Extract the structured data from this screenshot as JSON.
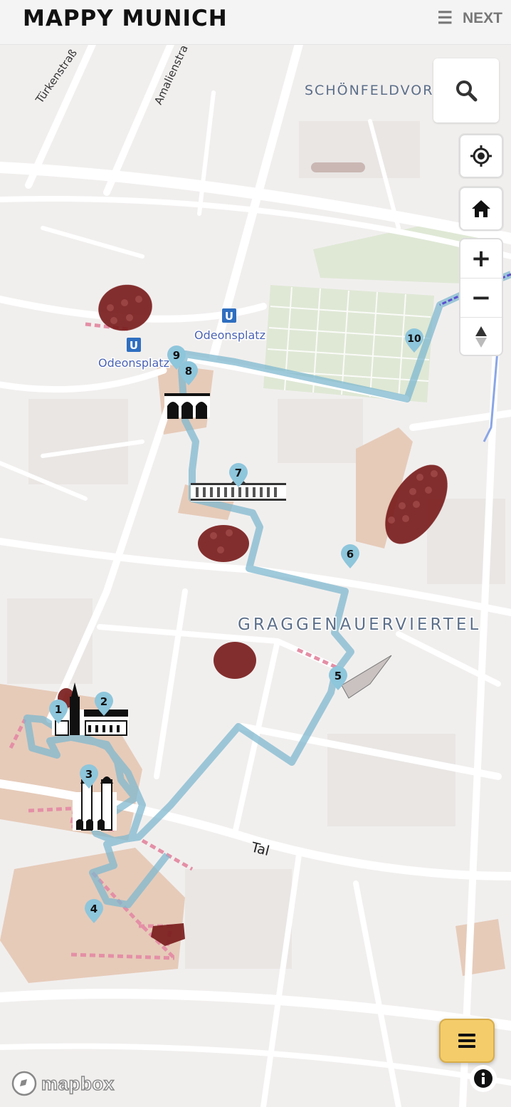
{
  "header": {
    "brand": "MAPPY MUNICH",
    "next_label": "NEXT",
    "menu_icon": "hamburger-icon"
  },
  "map": {
    "district_labels": [
      {
        "name": "district-label-schoenfeldvorstadt",
        "text": "SCHÖNFELDVOR"
      },
      {
        "name": "district-label-graggenauerviertel",
        "text": "GRAGGENAUERVIERTEL"
      }
    ],
    "street_labels": [
      {
        "name": "street-label-tuerkenstrasse",
        "text": "Türkenstraß"
      },
      {
        "name": "street-label-amalienstrasse",
        "text": "Amalienstra"
      },
      {
        "name": "street-label-tal",
        "text": "Tal"
      }
    ],
    "transit_stations": [
      {
        "name": "ubahn-odeonsplatz-east",
        "symbol": "U",
        "label": "Odeonsplatz"
      },
      {
        "name": "ubahn-odeonsplatz-west",
        "symbol": "U",
        "label": "Odeonsplatz"
      }
    ],
    "route_markers": [
      "1",
      "2",
      "3",
      "4",
      "5",
      "6",
      "7",
      "8",
      "9",
      "10"
    ],
    "colors": {
      "route": "#7fb8cf",
      "marker": "#8ec6dc",
      "area": "#7a1d1d",
      "pedestrian": "#e6cbb9",
      "park": "#dfe8d5",
      "label_blue": "#4a63b5",
      "menu_accent": "#f4cc6a"
    }
  },
  "controls": {
    "search_icon": "search-icon",
    "locate_icon": "locate-icon",
    "home_icon": "home-icon",
    "zoom_in": "+",
    "zoom_out": "−",
    "compass_icon": "compass-icon",
    "info_icon": "info-icon",
    "attribution": "mapbox"
  }
}
